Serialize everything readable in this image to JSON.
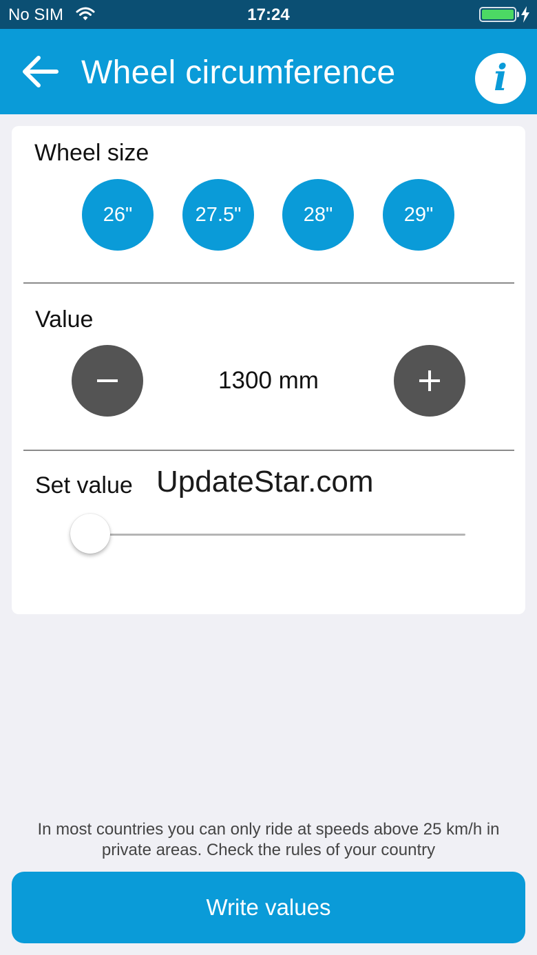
{
  "status_bar": {
    "carrier": "No SIM",
    "time": "17:24",
    "battery_level": 1.0
  },
  "header": {
    "title": "Wheel circumference",
    "info_label": "i",
    "back_icon": "arrow-left-icon"
  },
  "wheel_size": {
    "label": "Wheel size",
    "options": [
      "26\"",
      "27.5\"",
      "28\"",
      "29\""
    ]
  },
  "value": {
    "label": "Value",
    "display": "1300 mm",
    "decrement_icon": "minus-icon",
    "increment_icon": "plus-icon"
  },
  "set_value": {
    "label": "Set value",
    "slider_fraction": 0.0
  },
  "watermark": "UpdateStar.com",
  "notice": "In most countries you can only ride at speeds above 25 km/h in private areas. Check the rules of your country",
  "write_button": "Write values",
  "colors": {
    "accent": "#0a9bd8",
    "status_bar": "#0b4f73",
    "dark_button": "#545454",
    "battery": "#4cd964",
    "background": "#f0f0f5"
  }
}
